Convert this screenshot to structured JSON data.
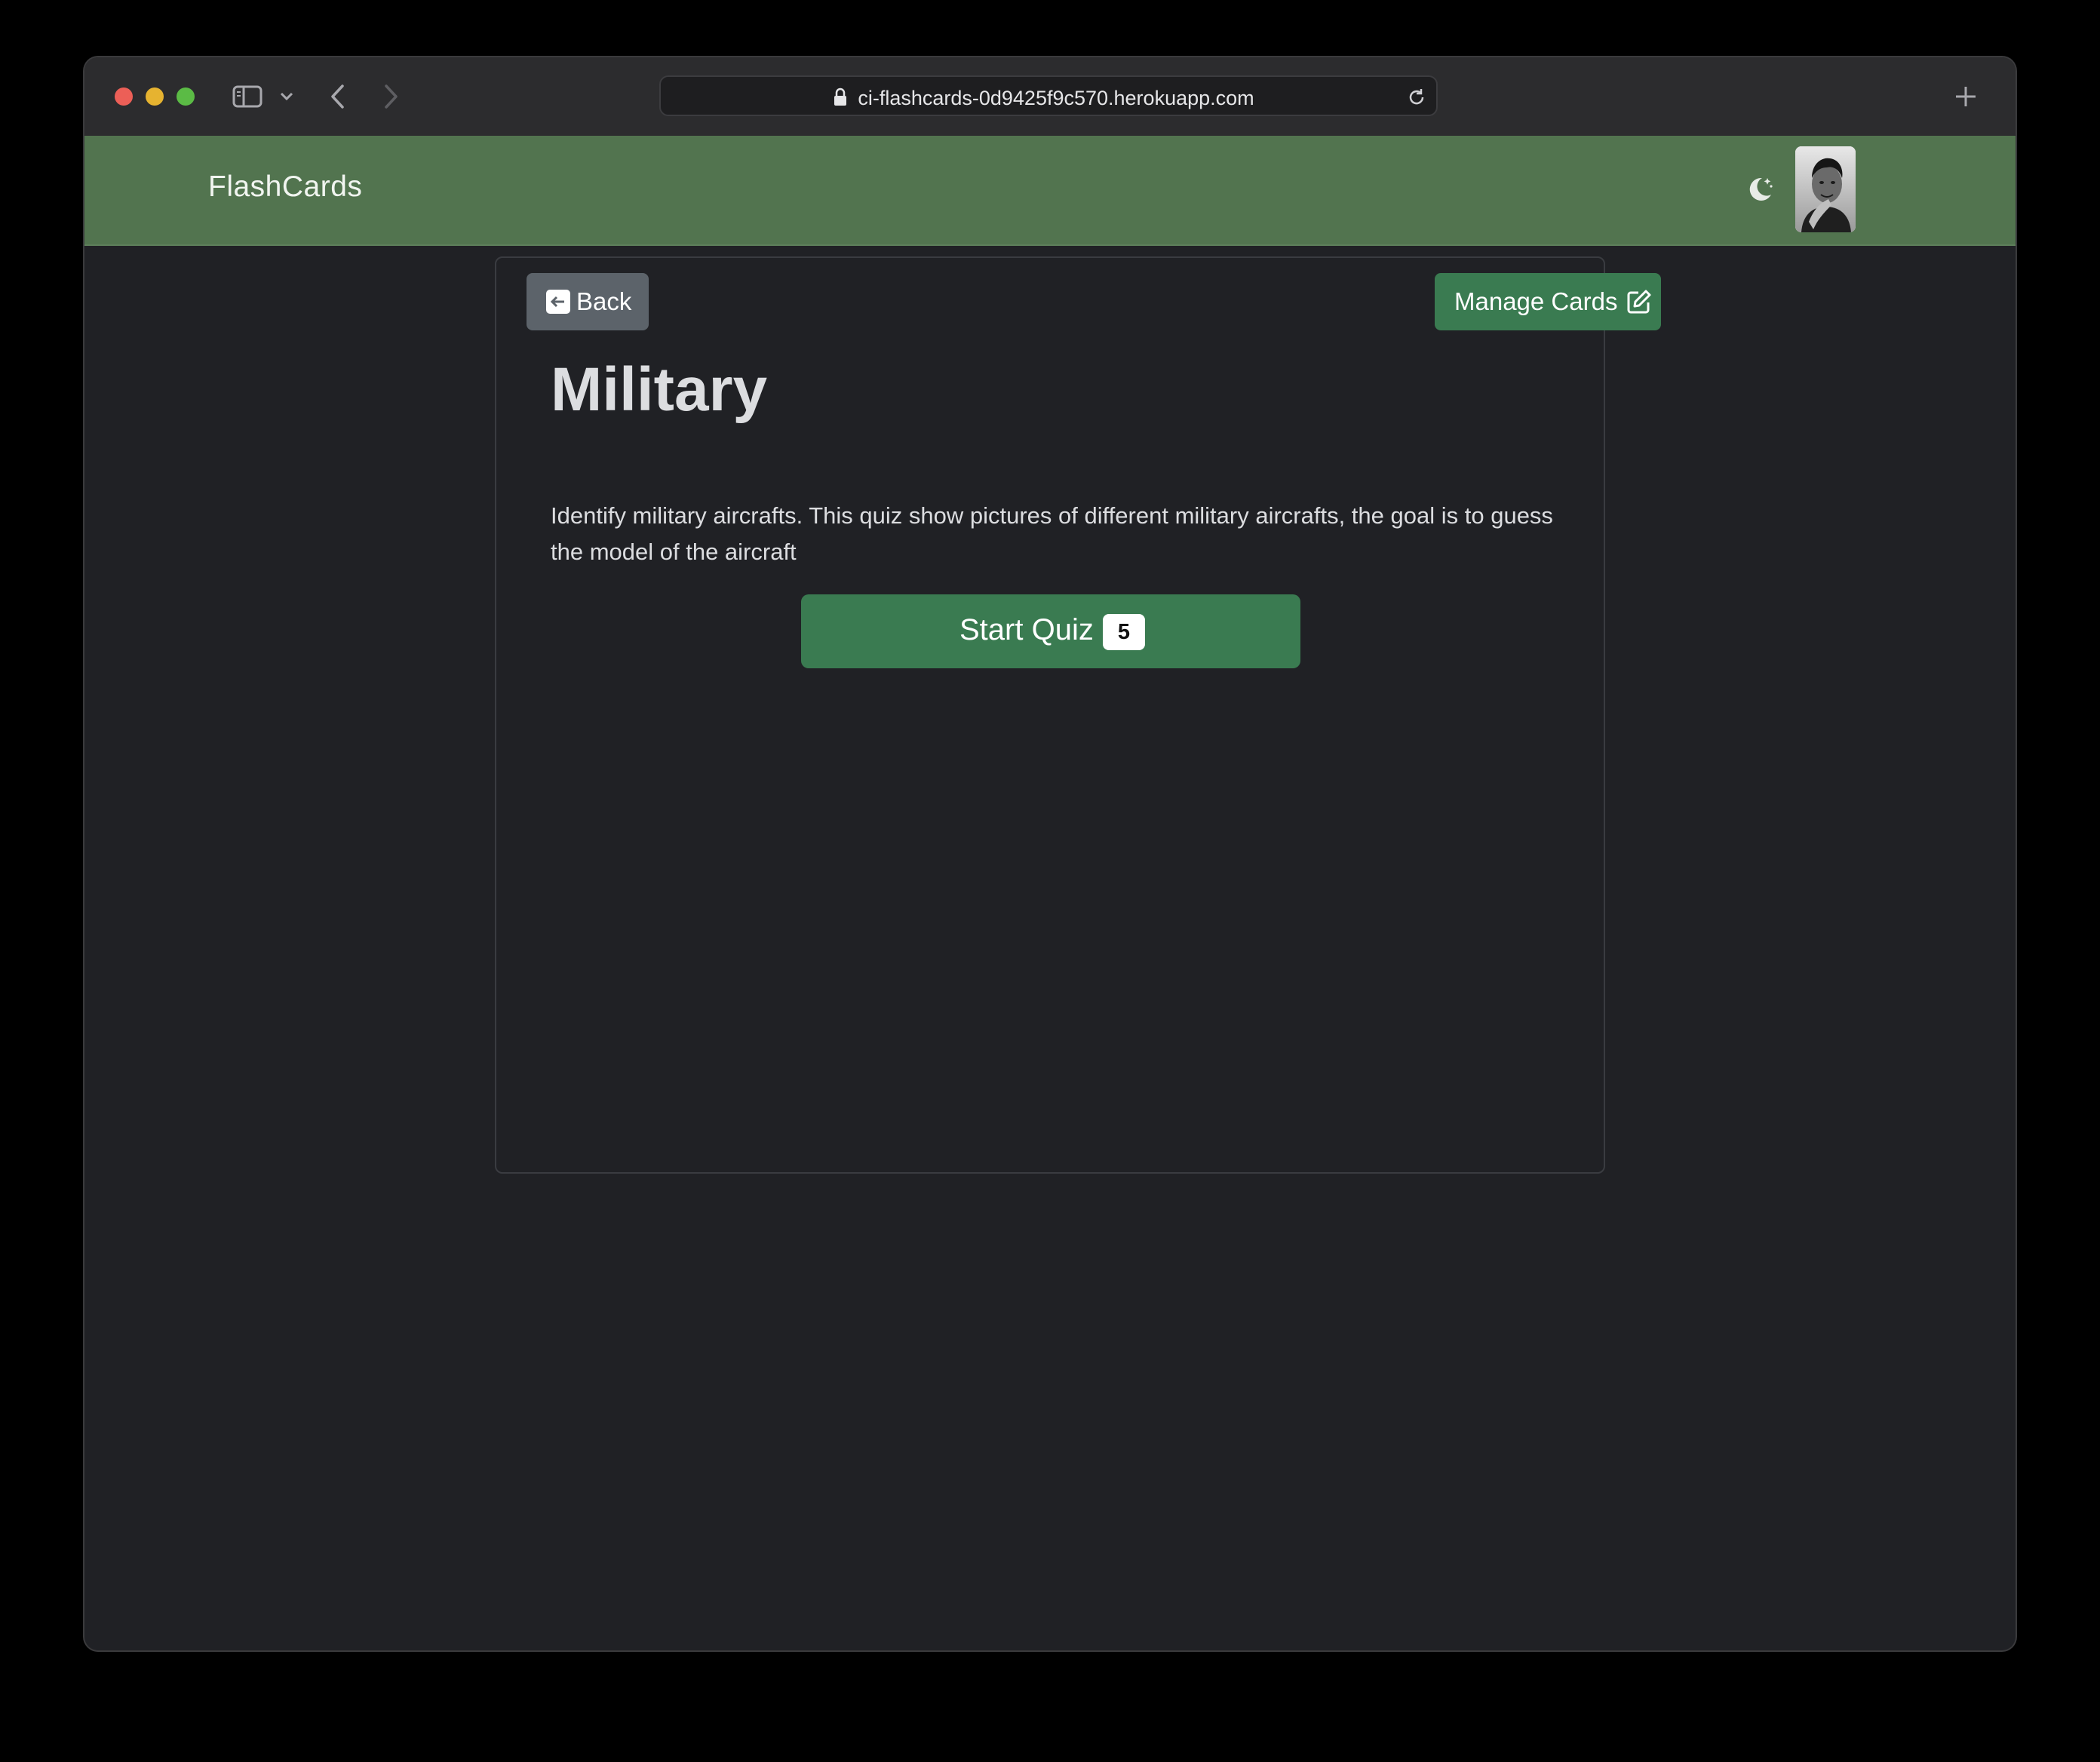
{
  "browser": {
    "url": "ci-flashcards-0d9425f9c570.herokuapp.com"
  },
  "navbar": {
    "brand": "FlashCards",
    "theme_toggle_icon": "moon-stars-icon",
    "avatar_icon": "user-avatar"
  },
  "deck": {
    "back_label": "Back",
    "manage_label": "Manage Cards",
    "title": "Military",
    "description": "Identify military aircrafts. This quiz show pictures of different military aircrafts, the goal is to guess the model of the aircraft",
    "start_label": "Start Quiz",
    "card_count": "5"
  },
  "colors": {
    "navbar_bg": "#52744f",
    "page_bg": "#202125",
    "primary_button": "#3a7b51",
    "secondary_button": "#5c636a"
  }
}
